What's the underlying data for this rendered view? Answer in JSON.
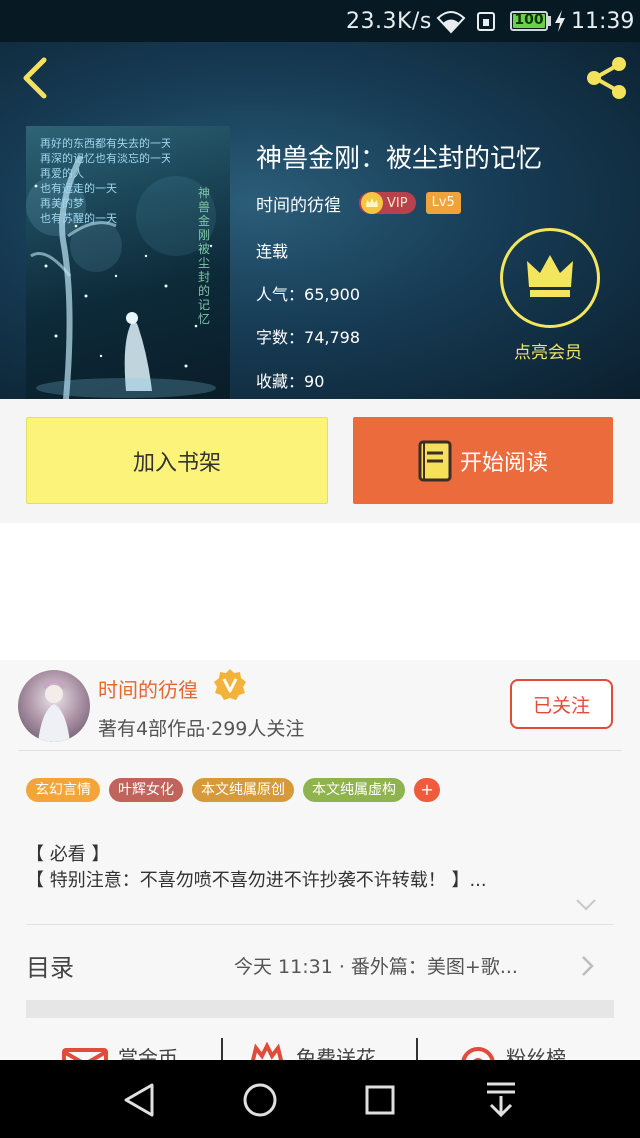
{
  "status_bar": {
    "net_speed": "23.3K/s",
    "battery": "100",
    "time": "11:39"
  },
  "book": {
    "title": "神兽金刚：被尘封的记忆",
    "author": "时间的彷徨",
    "vip_label": "VIP",
    "level": "Lv5",
    "status": "连载",
    "stats": [
      {
        "label": "人气：",
        "value": "65,900"
      },
      {
        "label": "字数：",
        "value": "74,798"
      },
      {
        "label": "收藏：",
        "value": "90"
      }
    ],
    "member_label": "点亮会员"
  },
  "cover": {
    "poem_lines": [
      "再好的东西都有失去的一天",
      "再深的记忆也有淡忘的一天",
      "再爱的人",
      "也有远走的一天",
      "再美的梦",
      "也有苏醒的一天"
    ],
    "vertical_text": "神兽金刚被尘封的记忆"
  },
  "actions": {
    "add_shelf": "加入书架",
    "start_read": "开始阅读"
  },
  "author_info": {
    "name": "时间的彷徨",
    "works": "著有4部作品·299人关注",
    "follow": "已关注"
  },
  "tags": [
    {
      "label": "玄幻言情",
      "color": "#f3a53a"
    },
    {
      "label": "叶辉女化",
      "color": "#c0635a"
    },
    {
      "label": "本文纯属原创",
      "color": "#d69a3a"
    },
    {
      "label": "本文纯属虚构",
      "color": "#8fb34e"
    }
  ],
  "tag_more": "+",
  "intro": [
    "【 必看 】",
    "【 特别注意：不喜勿喷不喜勿进不许抄袭不许转载！ 】..."
  ],
  "toc": {
    "label": "目录",
    "latest": "今天 11:31 · 番外篇：美图+歌..."
  },
  "bottom_actions": [
    "赏金币",
    "免费送花",
    "粉丝榜"
  ],
  "colors": {
    "accent_orange": "#ec6b3d",
    "shelf_yellow": "#fcf37a",
    "member_gold": "#f4e55e"
  }
}
